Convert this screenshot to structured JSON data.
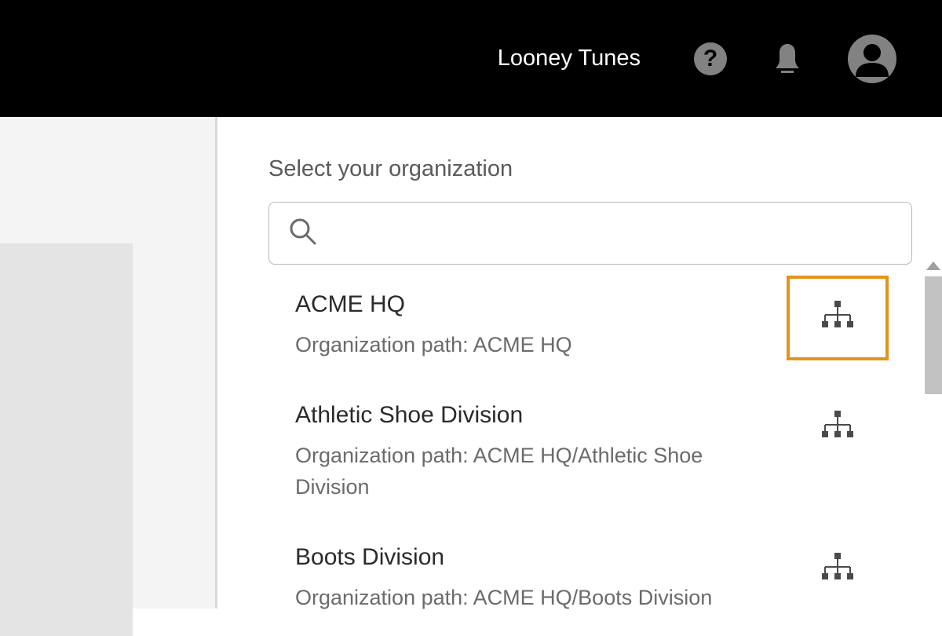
{
  "header": {
    "title": "Looney Tunes"
  },
  "main": {
    "section_title": "Select your organization",
    "search_placeholder": ""
  },
  "orgs": [
    {
      "name": "ACME HQ",
      "path": "Organization path: ACME HQ",
      "highlighted": true
    },
    {
      "name": "Athletic Shoe Division",
      "path": "Organization path: ACME HQ/Athletic Shoe Division",
      "highlighted": false
    },
    {
      "name": "Boots Division",
      "path": "Organization path: ACME HQ/Boots Division",
      "highlighted": false
    }
  ]
}
